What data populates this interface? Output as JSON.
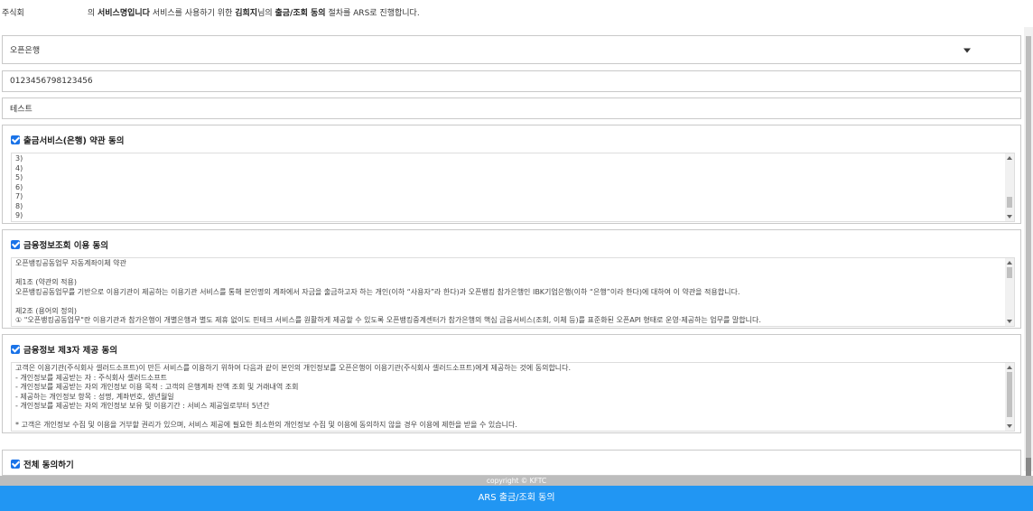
{
  "intro": {
    "prefix": "주식회",
    "mid": "의 ",
    "bold1": "서비스명입니다",
    "text1": " 서비스를 사용하기 위한 ",
    "bold2": "김희지",
    "text2": "님의 ",
    "bold3": "출금/조회 동의",
    "text3": " 절차를 ARS로 진행합니다."
  },
  "bank_select": {
    "value": "오픈은행"
  },
  "account_field": {
    "value": "0123456798123456"
  },
  "name_field": {
    "value": "테스트"
  },
  "sections": [
    {
      "title": "출금서비스(은행) 약관 동의",
      "lines": [
        "3)",
        "4)",
        "5)",
        "6)",
        "7)",
        "8)",
        "9)"
      ]
    },
    {
      "title": "금융정보조회 이용 동의",
      "lines": [
        "오픈뱅킹공동업무 자동계좌이체 약관",
        "",
        "제1조 (약관의 적용)",
        "오픈뱅킹공동업무를 기반으로 이용기관이 제공하는 이용기관 서비스를 통해 본인명의 계좌에서 자금을 출금하고자 하는 개인(이하 “사용자”라 한다)과 오픈뱅킹 참가은행인 IBK기업은행(이하 “은행”이라 한다)에 대하여 이 약관을 적용합니다.",
        "",
        "제2조 (용어의 정의)",
        "① \"오픈뱅킹공동업무\"란 이용기관과 참가은행이 개별은행과 별도 제휴 없이도 핀테크 서비스를 원활하게 제공할 수 있도록 오픈뱅킹중계센터가 참가은행의 핵심 금융서비스(조회, 이체 등)를 표준화된 오픈API 형태로 운영·제공하는 업무를 말합니다."
      ]
    },
    {
      "title": "금융정보 제3자 제공 동의",
      "lines": [
        "고객은 이용기관(주식회사 셀러드소프트)이 만든 서비스를 이용하기 위하여 다음과 같이 본인의 개인정보를 오픈은행이 이용기관(주식회사 셀러드소프트)에게 제공하는 것에 동의합니다.",
        "- 개인정보를 제공받는 자 : 주식회사 셀러드소프트",
        "- 개인정보를 제공받는 자의 개인정보 이용 목적 : 고객의 은행계좌 잔액 조회 및 거래내역 조회",
        "- 제공하는 개인정보 항목 : 성명, 계좌번호, 생년월일",
        "- 개인정보를 제공받는 자의 개인정보 보유 및 이용기간 : 서비스 제공일로부터 5년간",
        "",
        "* 고객은 개인정보 수집 및 이용을 거부할 권리가 있으며, 서비스 제공에 필요한 최소한의 개인정보 수집 및 이용에 동의하지 않을 경우 이용에 제한을 받을 수 있습니다."
      ]
    }
  ],
  "agree_all": {
    "label": "전체 동의하기"
  },
  "footer": {
    "copyright": "copyright © KFTC"
  },
  "submit": {
    "label": "ARS 출금/조회 동의"
  },
  "colors": {
    "accent": "#2196f3",
    "checkbox": "#1a73e8",
    "copybar": "#bdbdbd"
  }
}
